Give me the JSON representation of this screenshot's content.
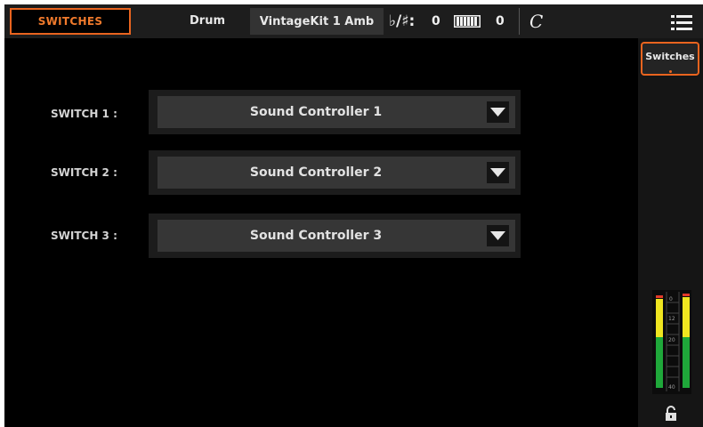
{
  "topbar": {
    "page_tab": "SWITCHES",
    "drum_label": "Drum",
    "kit_name": "VintageKit 1 Amb",
    "transpose_symbol": "♭/♯:",
    "transpose_value": "0",
    "octave_value": "0",
    "chord_icon": "C",
    "icons": [
      "keyboard-icon",
      "chord-icon",
      "menu-icon"
    ]
  },
  "switches": [
    {
      "label": "SWITCH 1 :",
      "value": "Sound Controller 1"
    },
    {
      "label": "SWITCH 2 :",
      "value": "Sound Controller 2"
    },
    {
      "label": "SWITCH 3 :",
      "value": "Sound Controller 3"
    }
  ],
  "sidebar": {
    "tab_label": "Switches",
    "meter_ticks": [
      "0",
      "12",
      "20",
      "40"
    ],
    "icons": [
      "lock-icon"
    ]
  },
  "colors": {
    "accent": "#e9641f",
    "background": "#000000",
    "panel": "#1c1c1c",
    "dropdown": "#363636"
  }
}
